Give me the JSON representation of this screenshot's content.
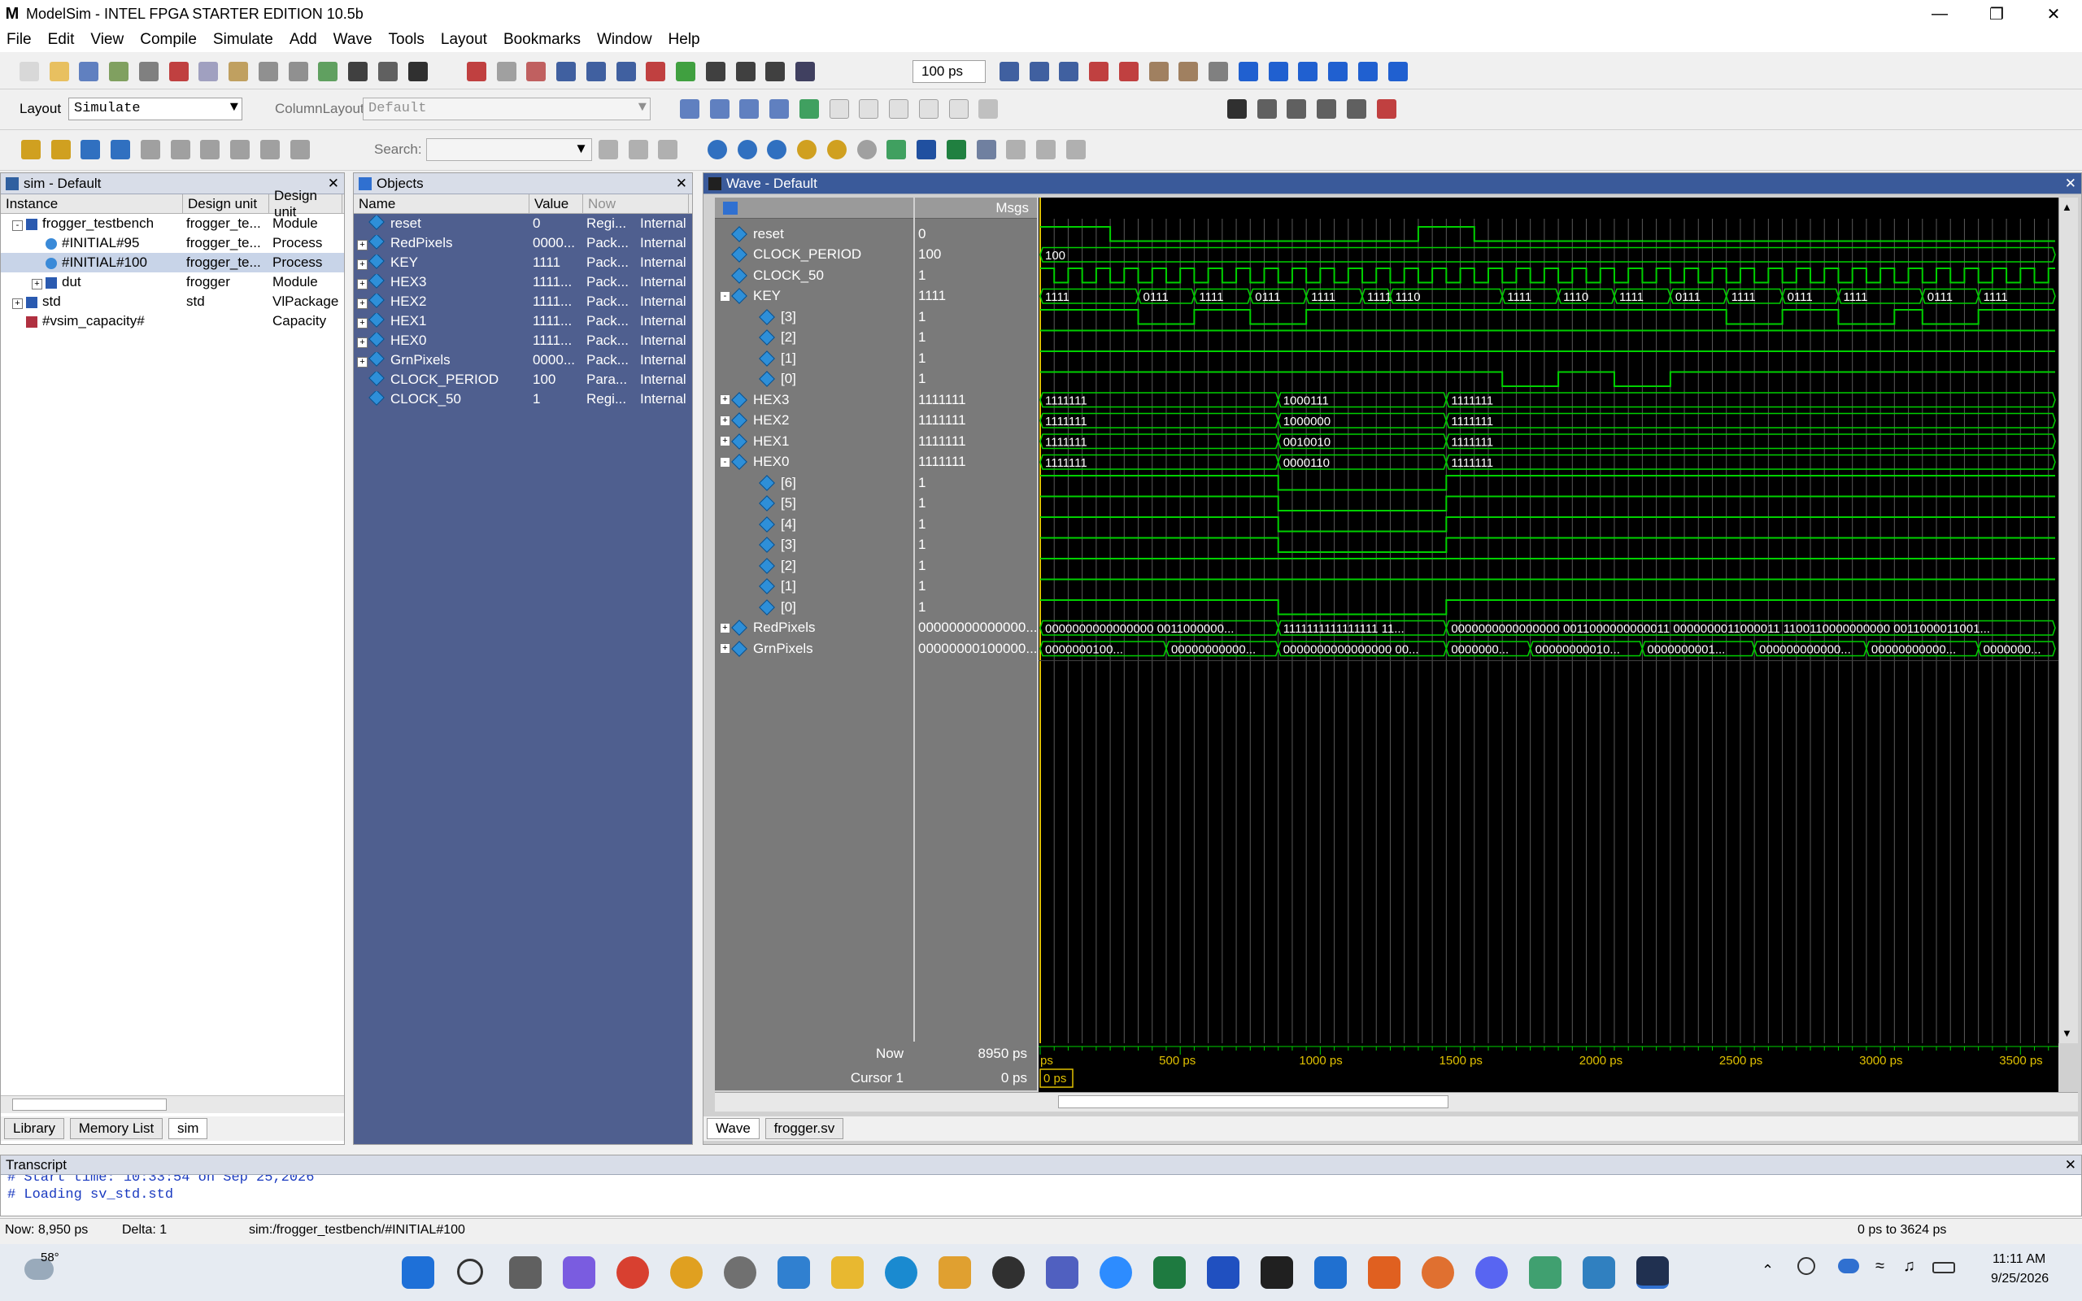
{
  "window": {
    "title": "ModelSim - INTEL FPGA STARTER EDITION 10.5b",
    "logo": "M"
  },
  "menu": [
    "File",
    "Edit",
    "View",
    "Compile",
    "Simulate",
    "Add",
    "Wave",
    "Tools",
    "Layout",
    "Bookmarks",
    "Window",
    "Help"
  ],
  "toolbar": {
    "time_step": "100 ps",
    "layout_label": "Layout",
    "layout_value": "Simulate",
    "column_layout_label": "ColumnLayout",
    "column_layout_value": "Default",
    "search_label": "Search:"
  },
  "sim_pane": {
    "title": "sim - Default",
    "columns": [
      "Instance",
      "Design unit",
      "Design unit"
    ],
    "rows": [
      {
        "name": "frogger_testbench",
        "unit": "frogger_te...",
        "type": "Module",
        "indent": 0,
        "expander": "-"
      },
      {
        "name": "#INITIAL#95",
        "unit": "frogger_te...",
        "type": "Process",
        "indent": 1,
        "expander": ""
      },
      {
        "name": "#INITIAL#100",
        "unit": "frogger_te...",
        "type": "Process",
        "indent": 1,
        "expander": "",
        "selected": true
      },
      {
        "name": "dut",
        "unit": "frogger",
        "type": "Module",
        "indent": 1,
        "expander": "+"
      },
      {
        "name": "std",
        "unit": "std",
        "type": "VlPackage",
        "indent": 0,
        "expander": "+"
      },
      {
        "name": "#vsim_capacity#",
        "unit": "",
        "type": "Capacity",
        "indent": 0,
        "expander": ""
      }
    ],
    "tabs": [
      "Library",
      "Memory List",
      "sim"
    ]
  },
  "objects_pane": {
    "title": "Objects",
    "columns": [
      "Name",
      "Value",
      "Now"
    ],
    "rows": [
      {
        "name": "reset",
        "value": "0",
        "kind": "Regi...",
        "mode": "Internal",
        "expander": ""
      },
      {
        "name": "RedPixels",
        "value": "0000...",
        "kind": "Pack...",
        "mode": "Internal",
        "expander": "+"
      },
      {
        "name": "KEY",
        "value": "1111",
        "kind": "Pack...",
        "mode": "Internal",
        "expander": "+"
      },
      {
        "name": "HEX3",
        "value": "1111...",
        "kind": "Pack...",
        "mode": "Internal",
        "expander": "+"
      },
      {
        "name": "HEX2",
        "value": "1111...",
        "kind": "Pack...",
        "mode": "Internal",
        "expander": "+"
      },
      {
        "name": "HEX1",
        "value": "1111...",
        "kind": "Pack...",
        "mode": "Internal",
        "expander": "+"
      },
      {
        "name": "HEX0",
        "value": "1111...",
        "kind": "Pack...",
        "mode": "Internal",
        "expander": "+"
      },
      {
        "name": "GrnPixels",
        "value": "0000...",
        "kind": "Pack...",
        "mode": "Internal",
        "expander": "+"
      },
      {
        "name": "CLOCK_PERIOD",
        "value": "100",
        "kind": "Para...",
        "mode": "Internal",
        "expander": ""
      },
      {
        "name": "CLOCK_50",
        "value": "1",
        "kind": "Regi...",
        "mode": "Internal",
        "expander": ""
      }
    ]
  },
  "wave_pane": {
    "title": "Wave - Default",
    "msgs_label": "Msgs",
    "signals": [
      {
        "name": "reset",
        "value": "0",
        "indent": 0,
        "expander": ""
      },
      {
        "name": "CLOCK_PERIOD",
        "value": "100",
        "indent": 0,
        "expander": ""
      },
      {
        "name": "CLOCK_50",
        "value": "1",
        "indent": 0,
        "expander": ""
      },
      {
        "name": "KEY",
        "value": "1111",
        "indent": 0,
        "expander": "-"
      },
      {
        "name": "[3]",
        "value": "1",
        "indent": 1,
        "expander": ""
      },
      {
        "name": "[2]",
        "value": "1",
        "indent": 1,
        "expander": ""
      },
      {
        "name": "[1]",
        "value": "1",
        "indent": 1,
        "expander": ""
      },
      {
        "name": "[0]",
        "value": "1",
        "indent": 1,
        "expander": ""
      },
      {
        "name": "HEX3",
        "value": "1111111",
        "indent": 0,
        "expander": "+"
      },
      {
        "name": "HEX2",
        "value": "1111111",
        "indent": 0,
        "expander": "+"
      },
      {
        "name": "HEX1",
        "value": "1111111",
        "indent": 0,
        "expander": "+"
      },
      {
        "name": "HEX0",
        "value": "1111111",
        "indent": 0,
        "expander": "-"
      },
      {
        "name": "[6]",
        "value": "1",
        "indent": 1,
        "expander": ""
      },
      {
        "name": "[5]",
        "value": "1",
        "indent": 1,
        "expander": ""
      },
      {
        "name": "[4]",
        "value": "1",
        "indent": 1,
        "expander": ""
      },
      {
        "name": "[3]",
        "value": "1",
        "indent": 1,
        "expander": ""
      },
      {
        "name": "[2]",
        "value": "1",
        "indent": 1,
        "expander": ""
      },
      {
        "name": "[1]",
        "value": "1",
        "indent": 1,
        "expander": ""
      },
      {
        "name": "[0]",
        "value": "1",
        "indent": 1,
        "expander": ""
      },
      {
        "name": "RedPixels",
        "value": "00000000000000...",
        "indent": 0,
        "expander": "+"
      },
      {
        "name": "GrnPixels",
        "value": "00000000100000...",
        "indent": 0,
        "expander": "+"
      }
    ],
    "now_label": "Now",
    "now_value": "8950 ps",
    "cursor_label": "Cursor 1",
    "cursor_value": "0 ps",
    "cursor_readout": "0 ps",
    "time_axis": {
      "start_label": "ps",
      "ticks": [
        "500 ps",
        "1000 ps",
        "1500 ps",
        "2000 ps",
        "2500 ps",
        "3000 ps",
        "3500 ps"
      ]
    },
    "bus_labels": {
      "CLOCK_PERIOD": [
        "100"
      ],
      "KEY": [
        "1111",
        "0111",
        "1111",
        "0111",
        "1111",
        "1111",
        "1110",
        "1111",
        "1110",
        "1111",
        "0111",
        "1111",
        "0111",
        "1111",
        "0111",
        "1111"
      ],
      "HEX3": [
        "1111111",
        "1000111",
        "1111111"
      ],
      "HEX2": [
        "1111111",
        "1000000",
        "1111111"
      ],
      "HEX1": [
        "1111111",
        "0010010",
        "1111111"
      ],
      "HEX0": [
        "1111111",
        "0000110",
        "1111111"
      ],
      "RedPixels": [
        "0000000000000000 0011000000...",
        "1111111111111111 11...",
        "0000000000000000 0011000000000011 0000000011000011 1100110000000000 0011000011001..."
      ],
      "GrnPixels": [
        "0000000100...",
        "00000000000...",
        "0000000000000000 00...",
        "0000000...",
        "00000000010...",
        "0000000001...",
        "000000000000...",
        "00000000000...",
        "0000000..."
      ]
    },
    "tabs": [
      "Wave",
      "frogger.sv"
    ]
  },
  "transcript": {
    "title": "Transcript",
    "lines": [
      "# Start time: 10:33:54 on Sep 25,2026",
      "# Loading sv_std.std"
    ]
  },
  "statusbar": {
    "now": "Now: 8,950 ps",
    "delta": "Delta: 1",
    "path": "sim:/frogger_testbench/#INITIAL#100",
    "range": "0 ps to 3624 ps"
  },
  "taskbar": {
    "weather": "58°",
    "time": "11:11 AM",
    "date": "9/25/2026"
  },
  "colors": {
    "objects_bg": "#4f5f8f",
    "wave_name_bg": "#808080",
    "wave_bg": "#000000",
    "wave_green": "#00d000",
    "cursor_yellow": "#e0c000"
  }
}
